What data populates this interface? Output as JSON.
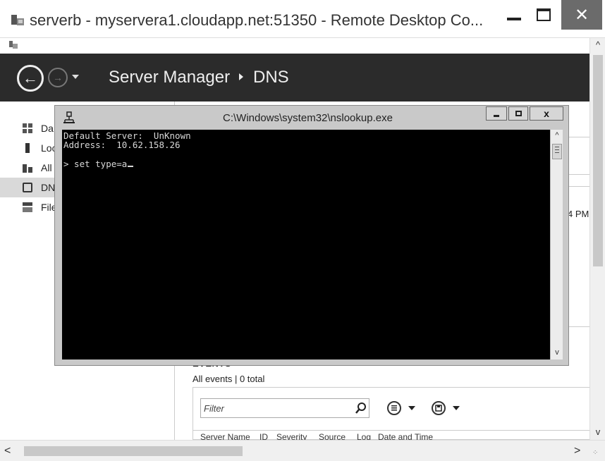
{
  "rdp": {
    "title": "serverb - myservera1.cloudapp.net:51350 - Remote Desktop Co...",
    "minimize_icon": "minimize-icon",
    "maximize_icon": "maximize-icon",
    "close_label": "✕"
  },
  "server_manager": {
    "breadcrumb_root": "Server Manager",
    "breadcrumb_current": "DNS"
  },
  "sidebar": {
    "items": [
      {
        "label": "Da",
        "icon": "dashboard-icon"
      },
      {
        "label": "Loc",
        "icon": "local-server-icon"
      },
      {
        "label": "All",
        "icon": "all-servers-icon"
      },
      {
        "label": "DN",
        "icon": "dns-icon",
        "selected": true
      },
      {
        "label": "File",
        "icon": "file-services-icon"
      }
    ]
  },
  "main": {
    "partial_time": "4 PM",
    "events_title": "EVENTS",
    "events_subtitle": "All events | 0 total",
    "filter_placeholder": "Filter",
    "columns": [
      "Server Name",
      "ID",
      "Severity",
      "Source",
      "Log",
      "Date and Time"
    ]
  },
  "console": {
    "title": "C:\\Windows\\system32\\nslookup.exe",
    "close_label": "x",
    "lines": [
      "Default Server:  UnKnown",
      "Address:  10.62.158.26",
      "> set type=a"
    ]
  },
  "scrollbars": {
    "up": "^",
    "down": "v",
    "left": "<",
    "right": ">"
  },
  "colors": {
    "header_bg": "#2b2b2b",
    "console_bg": "#000000",
    "console_text": "#d8d8d8",
    "rdp_close_bg": "#6b6b6b"
  }
}
